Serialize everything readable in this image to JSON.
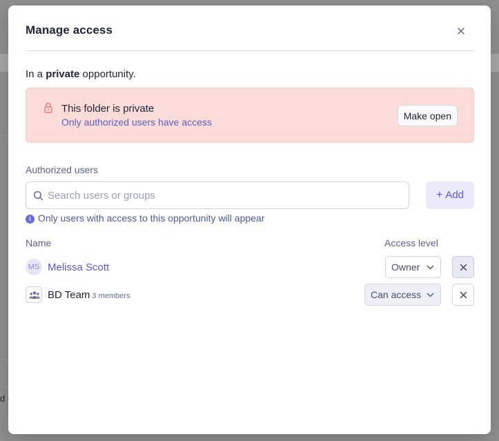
{
  "modal": {
    "title": "Manage access",
    "intro_prefix": "In a ",
    "intro_bold": "private",
    "intro_suffix": " opportunity."
  },
  "alert": {
    "title": "This folder is private",
    "subtitle": "Only authorized users have access",
    "button_label": "Make open"
  },
  "authorized": {
    "label": "Authorized users",
    "search_placeholder": "Search users or groups",
    "search_value": "",
    "add_label": "Add",
    "hint": "Only users with access to this opportunity will appear"
  },
  "table": {
    "col_name": "Name",
    "col_access": "Access level",
    "rows": [
      {
        "initials": "MS",
        "name": "Melissa Scott",
        "access": "Owner",
        "type": "user"
      },
      {
        "name": "BD Team",
        "members": "3 members",
        "access": "Can access",
        "type": "group"
      }
    ]
  },
  "background": {
    "fragment_text": "d c"
  },
  "icons": {
    "close": "close-icon",
    "lock": "lock-icon",
    "search": "search-icon",
    "plus": "plus-icon",
    "info": "info-icon",
    "group": "group-icon",
    "chevron": "chevron-down-icon",
    "remove": "x-icon"
  },
  "colors": {
    "accent": "#5a57d6",
    "alert_bg": "#fbdcd9",
    "lock": "#e07a7a",
    "overlay": "#8f8f92"
  }
}
